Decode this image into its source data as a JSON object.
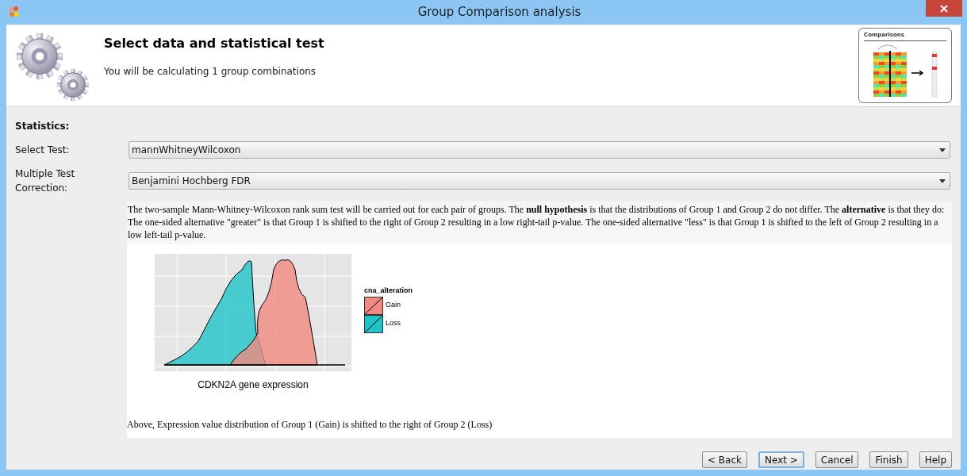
{
  "window": {
    "title": "Group Comparison analysis"
  },
  "header": {
    "title": "Select data and statistical test",
    "subtitle": "You will be calculating 1 group combinations",
    "thumbnail_title": "Comparisons"
  },
  "section_title": "Statistics:",
  "fields": [
    {
      "label": "Select Test:",
      "value": "mannWhitneyWilcoxon"
    },
    {
      "label": "Multiple Test Correction:",
      "value": "Benjamini Hochberg FDR"
    }
  ],
  "description": {
    "text": "The two-sample Mann-Whitney-Wilcoxon rank sum test will be carried out for each pair of groups. The **null hypothesis** is that the distributions of Group 1 and Group 2 do not differ. The **alternative** is that they do: The one-sided alternative \"greater\" is that Group 1 is shifted to the right of Group 2 resulting in a low right-tail p-value. The one-sided alternative \"less\" is that Group 1 is shifted to the left of Group 2 resulting in a low left-tail p-value.",
    "figure": {
      "xlabel": "CDKN2A gene expression",
      "legend_title": "cna_alteration",
      "legend": [
        {
          "label": "Gain",
          "color": "#f08a80"
        },
        {
          "label": "Loss",
          "color": "#1fc4c8"
        }
      ]
    },
    "caption": "Above, Expression value distribution of Group 1 (Gain) is shifted to the right of Group 2 (Loss)"
  },
  "buttons": [
    {
      "label": "< Back",
      "default": false
    },
    {
      "label": "Next >",
      "default": true
    },
    {
      "label": "Cancel",
      "default": false
    },
    {
      "label": "Finish",
      "default": false
    },
    {
      "label": "Help",
      "default": false
    }
  ]
}
